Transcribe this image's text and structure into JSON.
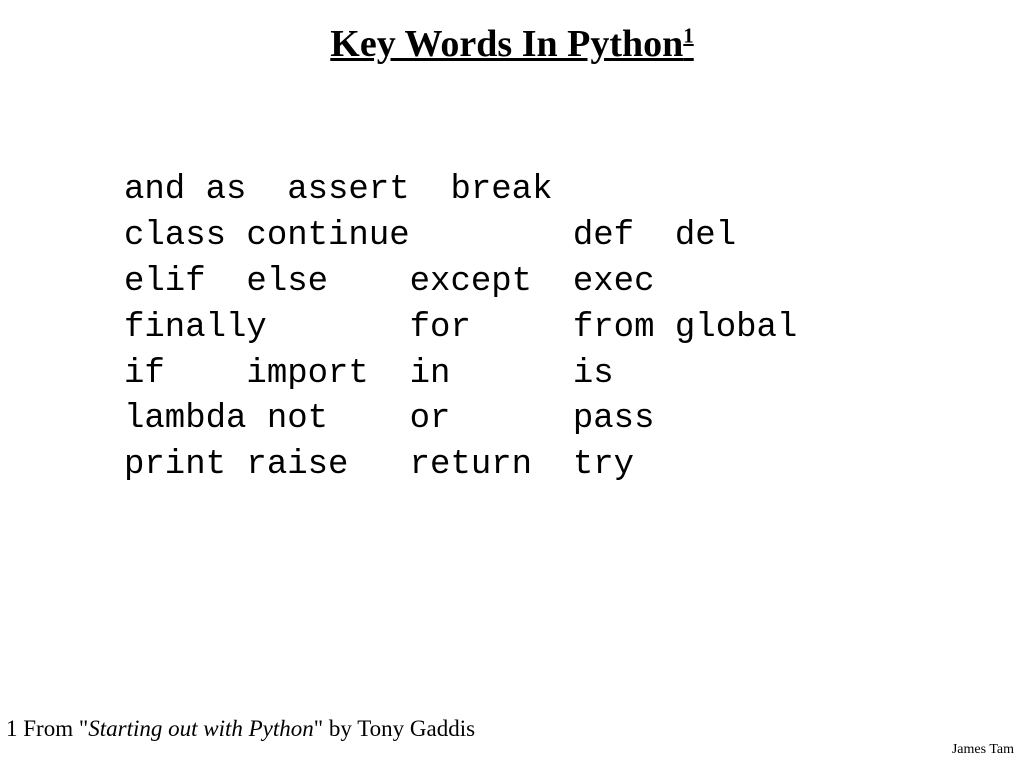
{
  "title": {
    "text": "Key Words In Python",
    "sup": "1"
  },
  "keywords_block": "and as  assert  break\nclass continue        def  del\nelif  else    except  exec\nfinally       for     from global\nif    import  in      is\nlambda not    or      pass\nprint raise   return  try",
  "footnote": {
    "before": "1 From \"",
    "italic": "Starting out with Python",
    "after": "\" by Tony Gaddis"
  },
  "author": "James Tam"
}
